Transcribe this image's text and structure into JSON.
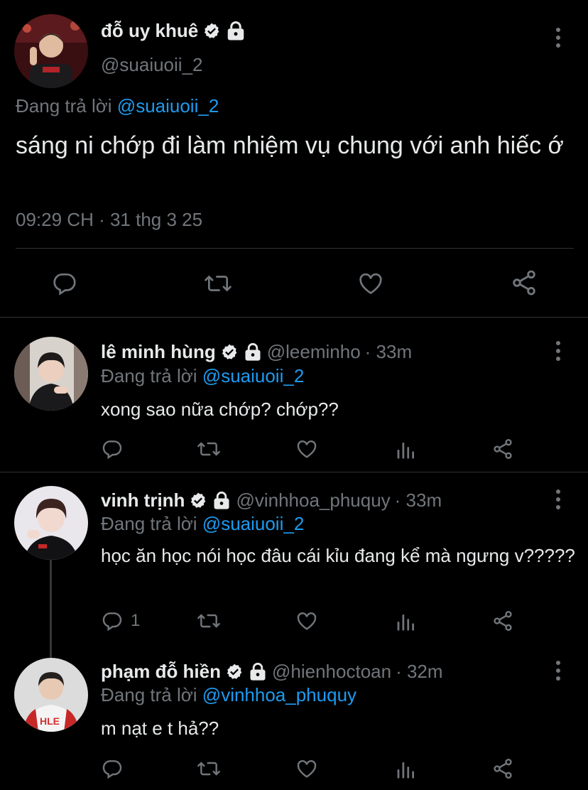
{
  "main_tweet": {
    "name": "đỗ uy khuê",
    "handle": "@suaiuoii_2",
    "replying_label": "Đang trả lời",
    "replying_to": "@suaiuoii_2",
    "text": "sáng ni chớp đi làm nhiệm vụ chung với anh hiếc ớ",
    "timestamp": "09:29 CH · 31 thg 3 25"
  },
  "replies": [
    {
      "name": "lê minh hùng",
      "handle": "@leeminho",
      "time": "· 33m",
      "replying_label": "Đang trả lời",
      "replying_to": "@suaiuoii_2",
      "text": "xong sao nữa chớp? chớp??",
      "reply_count": ""
    },
    {
      "name": "vinh trịnh",
      "handle": "@vinhhoa_phuquy",
      "time": "· 33m",
      "replying_label": "Đang trả lời",
      "replying_to": "@suaiuoii_2",
      "text": "học ăn học nói học đâu cái kỉu đang kể mà ngưng v?????",
      "reply_count": "1"
    },
    {
      "name": "phạm đỗ hiền",
      "handle": "@hienhoctoan",
      "time": "· 32m",
      "replying_label": "Đang trả lời",
      "replying_to": "@vinhhoa_phuquy",
      "text": "m nạt e t hả??",
      "reply_count": ""
    }
  ],
  "colors": {
    "background": "#000000",
    "text": "#e7e9ea",
    "muted": "#71767b",
    "link": "#1d9bf0",
    "divider": "#2f3336"
  },
  "icons": [
    "verified-badge-icon",
    "lock-icon",
    "more-icon",
    "reply-icon",
    "retweet-icon",
    "like-icon",
    "views-icon",
    "share-icon"
  ]
}
